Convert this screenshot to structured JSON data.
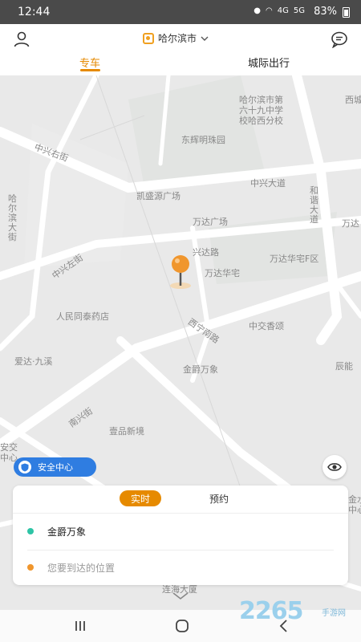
{
  "status_bar": {
    "time": "12:44",
    "network": "4G",
    "network2": "5G",
    "battery": "83%"
  },
  "header": {
    "city": "哈尔滨市",
    "tabs": [
      {
        "label": "专车",
        "active": true
      },
      {
        "label": "城际出行",
        "active": false
      }
    ]
  },
  "map": {
    "labels": [
      "哈尔滨市第",
      "六十九中学",
      "校哈西分校",
      "西城",
      "东辉明珠园",
      "中兴右街",
      "中兴大道",
      "和谐大道",
      "哈尔滨大街",
      "凯盛源广场",
      "万达广场",
      "万达",
      "中兴左街",
      "兴达路",
      "万达华宅F区",
      "万达华宅",
      "人民同泰药店",
      "中交香颂",
      "西宁南路",
      "爱达·九溪",
      "金爵万象",
      "辰能",
      "南兴街",
      "壹品新境",
      "安交",
      "中心",
      "金水",
      "中心",
      "连海大厦"
    ]
  },
  "safety_button": {
    "label": "安全中心"
  },
  "booking": {
    "modes": [
      {
        "label": "实时",
        "active": true
      },
      {
        "label": "预约",
        "active": false
      }
    ],
    "pickup": "金爵万象",
    "destination_placeholder": "您要到达的位置"
  },
  "watermark": {
    "main": "2265",
    "sub": "手游网"
  },
  "colors": {
    "accent": "#e68a00",
    "safety": "#2f7de1",
    "start_dot": "#2ec4a6",
    "end_dot": "#f0962d"
  },
  "icons": [
    "user-icon",
    "city-logo-icon",
    "chevron-down-icon",
    "message-icon",
    "location-pin-icon",
    "shield-icon",
    "locate-icon",
    "recents-icon",
    "home-icon",
    "back-icon"
  ]
}
